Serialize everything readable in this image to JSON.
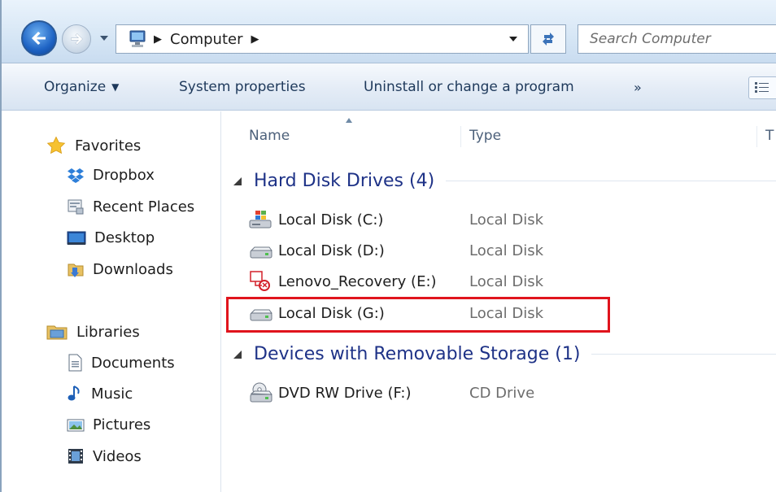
{
  "address": {
    "breadcrumb": "Computer",
    "search_placeholder": "Search Computer"
  },
  "commandbar": {
    "organize": "Organize",
    "system_properties": "System properties",
    "uninstall": "Uninstall or change a program",
    "more": "»"
  },
  "nav": {
    "favorites": "Favorites",
    "dropbox": "Dropbox",
    "recent_places": "Recent Places",
    "desktop": "Desktop",
    "downloads": "Downloads",
    "libraries": "Libraries",
    "documents": "Documents",
    "music": "Music",
    "pictures": "Pictures",
    "videos": "Videos"
  },
  "columns": {
    "name": "Name",
    "type": "Type",
    "more": "T"
  },
  "groups": {
    "hard_disks": "Hard Disk Drives (4)",
    "removable": "Devices with Removable Storage (1)"
  },
  "drives": [
    {
      "name": "Local Disk (C:)",
      "type": "Local Disk"
    },
    {
      "name": "Local Disk (D:)",
      "type": "Local Disk"
    },
    {
      "name": "Lenovo_Recovery (E:)",
      "type": "Local Disk"
    },
    {
      "name": "Local Disk (G:)",
      "type": "Local Disk"
    }
  ],
  "removable": [
    {
      "name": "DVD RW Drive (F:)",
      "type": "CD Drive"
    }
  ],
  "colors": {
    "highlight": "#e0141d",
    "group_text": "#1e3287",
    "command_text": "#1e395b"
  }
}
